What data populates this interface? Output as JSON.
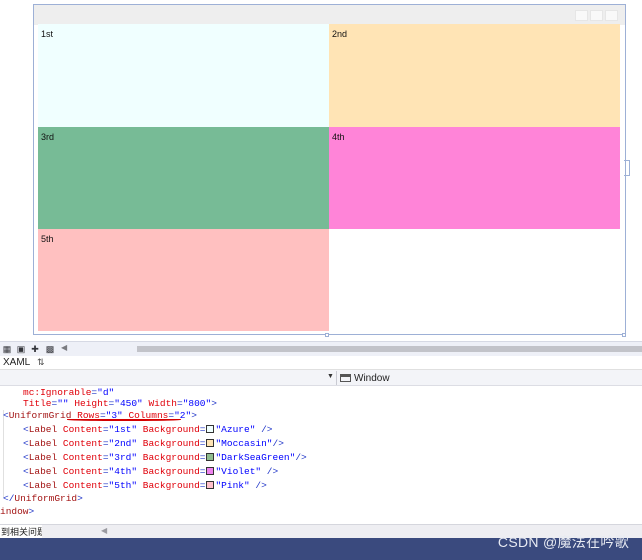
{
  "designer": {
    "cells": [
      {
        "label": "1st",
        "color": "#F0FFFF"
      },
      {
        "label": "2nd",
        "color": "#FFE4B5"
      },
      {
        "label": "3rd",
        "color": "#77BB96"
      },
      {
        "label": "4th",
        "color": "#FF84D8"
      },
      {
        "label": "5th",
        "color": "#FFC0C0"
      }
    ]
  },
  "toolbar": {
    "icons": [
      "grid-view-icon",
      "fit-to-screen-icon",
      "snapping-icon",
      "effects-icon"
    ]
  },
  "tabs": {
    "xaml_label": "XAML",
    "swap_icon": "swap-panes-icon"
  },
  "navbar": {
    "element_label": "Window"
  },
  "editor": {
    "lines": {
      "l1_attr": "mc:Ignorable",
      "l1_val": "\"d\"",
      "l2_a1": "Title",
      "l2_v1": "\"\"",
      "l2_a2": "Height",
      "l2_v2": "\"450\"",
      "l2_a3": "Width",
      "l2_v3": "\"800\"",
      "l2_end": ">",
      "l3_open": "<",
      "l3_tag": "UniformGrid",
      "l3_a1": "Rows",
      "l3_v1": "\"3\"",
      "l3_a2": "Columns",
      "l3_v2": "\"2\"",
      "l3_end": ">",
      "label_tag": "Label",
      "content_attr": "Content",
      "bg_attr": "Background",
      "closing_grid_tag": "UniformGrid",
      "closing_window_tag": "indow"
    },
    "labels": [
      {
        "content": "\"1st\"",
        "background": "\"Azure\"",
        "end": " />",
        "swatch": "#F0FFFF"
      },
      {
        "content": "\"2nd\"",
        "background": "\"Moccasin\"",
        "end": "/>",
        "swatch": "#FFE4B5"
      },
      {
        "content": "\"3rd\"",
        "background": "\"DarkSeaGreen\"",
        "end": "/>",
        "swatch": "#8FBC8F"
      },
      {
        "content": "\"4th\"",
        "background": "\"Violet\"",
        "end": " />",
        "swatch": "#EE82EE"
      },
      {
        "content": "\"5th\"",
        "background": "\"Pink\"",
        "end": " />",
        "swatch": "#FFC0CB"
      }
    ]
  },
  "errors": {
    "tab_label": "到相关问题"
  },
  "watermark": {
    "text": "CSDN @魔法在吟歌"
  },
  "colors": {
    "accent": "#3A4A7E",
    "frame": "#9DB0D6"
  }
}
